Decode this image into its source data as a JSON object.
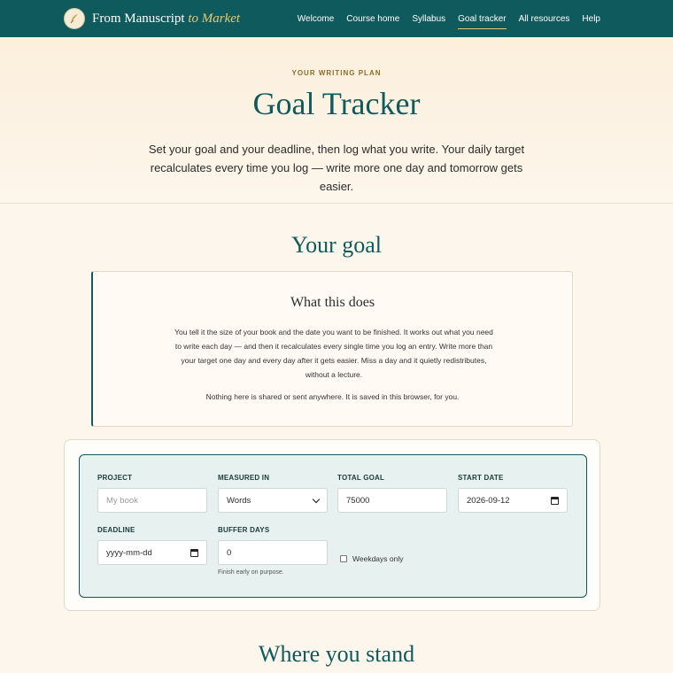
{
  "nav": {
    "brand_main": "From Manuscript",
    "brand_accent": "to Market",
    "links": [
      "Welcome",
      "Course home",
      "Syllabus",
      "Goal tracker",
      "All resources",
      "Help"
    ],
    "active": "Goal tracker"
  },
  "hero": {
    "eyebrow": "YOUR WRITING PLAN",
    "title": "Goal Tracker",
    "intro": "Set your goal and your deadline, then log what you write. Your daily target recalculates every time you log — write more one day and tomorrow gets easier."
  },
  "goal_section": {
    "title": "Your goal",
    "info": {
      "title": "What this does",
      "body": "You tell it the size of your book and the date you want to be finished. It works out what you need to write each day — and then it recalculates every single time you log an entry. Write more than your target one day and every day after it gets easier. Miss a day and it quietly redistributes, without a lecture.",
      "note": "Nothing here is shared or sent anywhere. It is saved in this browser, for you."
    }
  },
  "form": {
    "project": {
      "label": "PROJECT",
      "placeholder": "My book",
      "value": ""
    },
    "measured_in": {
      "label": "MEASURED IN",
      "value": "Words"
    },
    "total_goal": {
      "label": "TOTAL GOAL",
      "value": "75000"
    },
    "start_date": {
      "label": "START DATE",
      "value": "2026-09-12"
    },
    "deadline": {
      "label": "DEADLINE",
      "placeholder": "yyyy-mm-dd"
    },
    "buffer_days": {
      "label": "BUFFER DAYS",
      "value": "0",
      "hint": "Finish early on purpose."
    },
    "weekdays_only": {
      "label": "Weekdays only",
      "checked": false
    }
  },
  "stand_section": {
    "title": "Where you stand"
  },
  "colors": {
    "primary": "#0f5a5c",
    "accent": "#e6c97a",
    "background": "#fdf6ec"
  },
  "icons": {
    "brand_logo": "quill-icon",
    "date_picker": "calendar-icon",
    "select": "chevron-down-icon"
  }
}
